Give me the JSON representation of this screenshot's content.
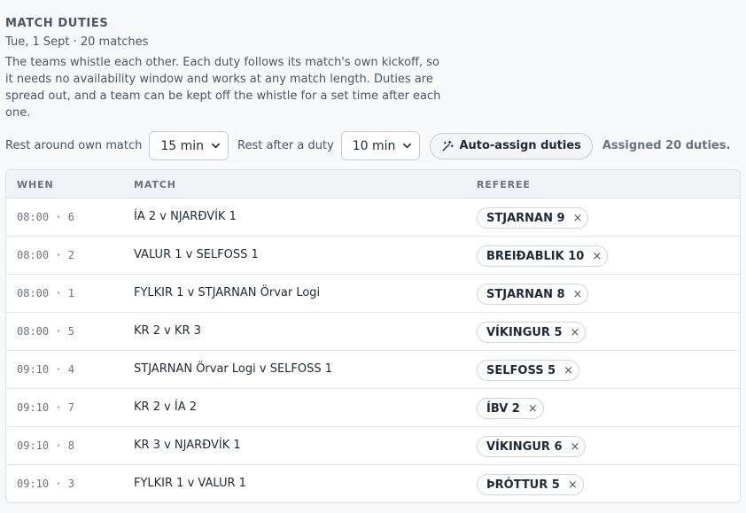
{
  "header": {
    "title": "MATCH DUTIES",
    "subtitle": "Tue, 1 Sept · 20 matches",
    "description": "The teams whistle each other. Each duty follows its match's own kickoff, so it needs no availability window and works at any match length. Duties are spread out, and a team can be kept off the whistle for a set time after each one."
  },
  "controls": {
    "rest_own_label": "Rest around own match",
    "rest_own_value": "15 min",
    "rest_duty_label": "Rest after a duty",
    "rest_duty_value": "10 min",
    "auto_assign_label": "Auto-assign duties",
    "status": "Assigned 20 duties."
  },
  "table": {
    "columns": [
      "WHEN",
      "MATCH",
      "REFEREE"
    ],
    "rows": [
      {
        "when": "08:00 · 6",
        "match": "ÍA 2 v NJARÐVÍK 1",
        "referee": "STJARNAN 9"
      },
      {
        "when": "08:00 · 2",
        "match": "VALUR 1 v SELFOSS 1",
        "referee": "BREIÐABLIK 10"
      },
      {
        "when": "08:00 · 1",
        "match": "FYLKIR 1 v STJARNAN Örvar Logi",
        "referee": "STJARNAN 8"
      },
      {
        "when": "08:00 · 5",
        "match": "KR 2 v KR 3",
        "referee": "VÍKINGUR 5"
      },
      {
        "when": "09:10 · 4",
        "match": "STJARNAN Örvar Logi v SELFOSS 1",
        "referee": "SELFOSS 5"
      },
      {
        "when": "09:10 · 7",
        "match": "KR 2 v ÍA 2",
        "referee": "ÍBV 2"
      },
      {
        "when": "09:10 · 8",
        "match": "KR 3 v NJARÐVÍK 1",
        "referee": "VÍKINGUR 6"
      },
      {
        "when": "09:10 · 3",
        "match": "FYLKIR 1 v VALUR 1",
        "referee": "ÞRÓTTUR 5"
      }
    ],
    "remove_glyph": "×"
  },
  "icons": {
    "wand": "magic-wand-icon",
    "chevron": "chevron-down-icon",
    "remove": "close-icon"
  }
}
